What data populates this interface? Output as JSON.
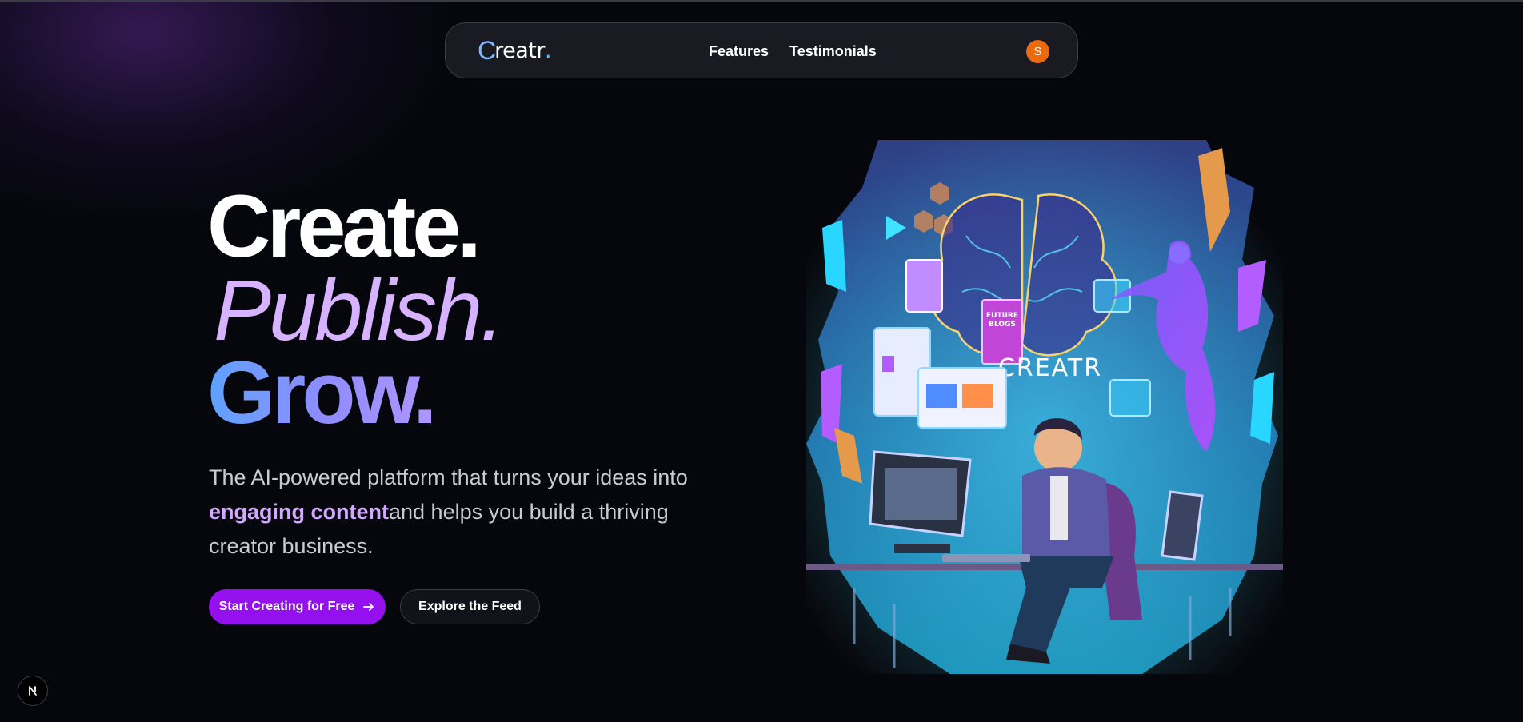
{
  "nav": {
    "logo_text": "Creatr",
    "logo_letter": "C",
    "logo_rest": "reatr",
    "logo_dot": ".",
    "links": [
      {
        "label": "Features"
      },
      {
        "label": "Testimonials"
      }
    ],
    "avatar_initial": "S"
  },
  "hero": {
    "headline": {
      "line1": "Create.",
      "line2": "Publish.",
      "line3": "Grow."
    },
    "subtitle": {
      "part1": "The AI-powered platform that turns your ideas into ",
      "highlight": "engaging content",
      "part2": "and helps you build a thriving creator business."
    },
    "primary_button": "Start Creating for Free",
    "secondary_button": "Explore the Feed"
  },
  "illustration": {
    "brand_text": "CREATR",
    "book_text_1": "FUTURE",
    "book_text_2": "BLOGS"
  },
  "icons": {
    "primary_button_icon": "arrow-right-icon",
    "corner_badge_icon": "next-logo-icon"
  },
  "colors": {
    "background": "#06070c",
    "primary": "#9410ee",
    "accent_purple": "#d3a9ff",
    "avatar": "#ea6a0c"
  }
}
